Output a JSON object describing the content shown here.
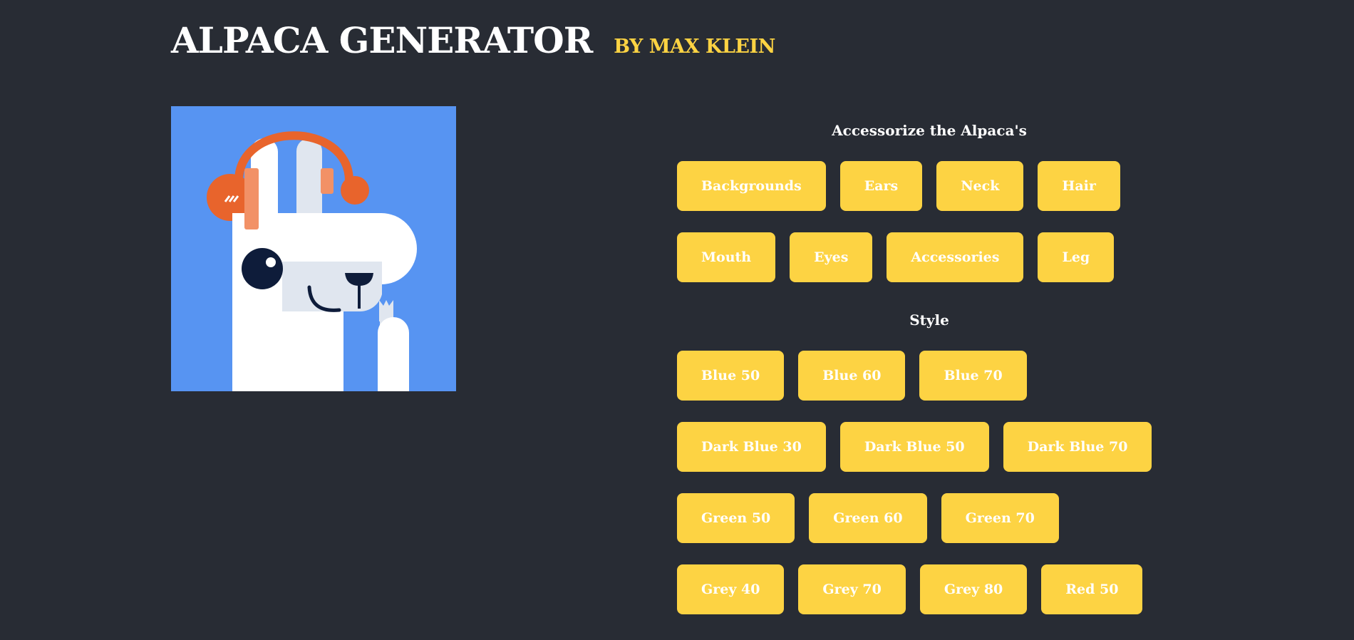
{
  "header": {
    "title": "ALPACA GENERATOR",
    "byline": "BY MAX KLEIN"
  },
  "preview": {
    "background_color": "#5794f2",
    "headphones_color": "#e8642c"
  },
  "accessorize": {
    "heading": "Accessorize the Alpaca's",
    "rows": [
      [
        "Backgrounds",
        "Ears",
        "Neck",
        "Hair"
      ],
      [
        "Mouth",
        "Eyes",
        "Accessories",
        "Leg"
      ]
    ]
  },
  "style": {
    "heading": "Style",
    "rows": [
      [
        "Blue 50",
        "Blue 60",
        "Blue 70"
      ],
      [
        "Dark Blue 30",
        "Dark Blue 50",
        "Dark Blue 70"
      ],
      [
        "Green 50",
        "Green 60",
        "Green 70"
      ],
      [
        "Grey 40",
        "Grey 70",
        "Grey 80",
        "Red 50"
      ]
    ]
  },
  "colors": {
    "page_bg": "#282c34",
    "accent": "#fdd343"
  }
}
